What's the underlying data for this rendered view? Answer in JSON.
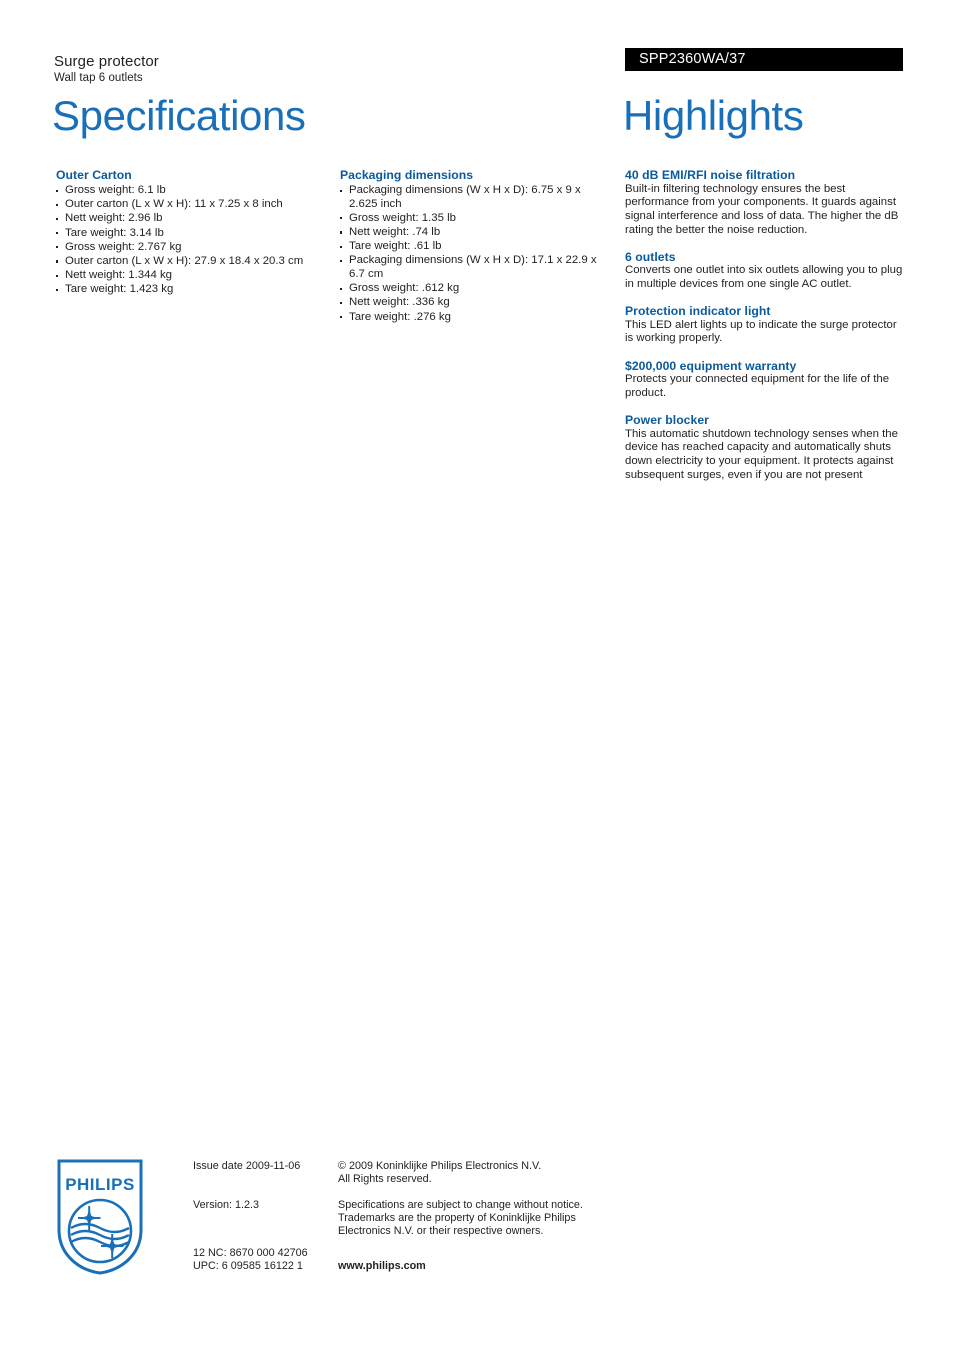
{
  "header": {
    "product_category": "Surge protector",
    "product_subtitle": "Wall tap 6 outlets",
    "product_code": "SPP2360WA/37",
    "title_left": "Specifications",
    "title_right": "Highlights"
  },
  "specifications": [
    {
      "heading": "Outer Carton",
      "items": [
        "Gross weight: 6.1 lb",
        "Outer carton (L x W x H): 11 x 7.25 x 8 inch",
        "Nett weight: 2.96 lb",
        "Tare weight: 3.14 lb",
        "Gross weight: 2.767 kg",
        "Outer carton (L x W x H): 27.9 x 18.4 x 20.3 cm",
        "Nett weight: 1.344 kg",
        "Tare weight: 1.423 kg"
      ]
    },
    {
      "heading": "Packaging dimensions",
      "items": [
        "Packaging dimensions (W x H x D): 6.75 x 9 x 2.625 inch",
        "Gross weight: 1.35 lb",
        "Nett weight: .74 lb",
        "Tare weight: .61 lb",
        "Packaging dimensions (W x H x D): 17.1 x 22.9 x 6.7 cm",
        "Gross weight: .612 kg",
        "Nett weight: .336 kg",
        "Tare weight: .276 kg"
      ]
    }
  ],
  "highlights": [
    {
      "title": "40 dB EMI/RFI noise filtration",
      "body": "Built-in filtering technology ensures the best performance from your components. It guards against signal interference and loss of data. The higher the dB rating the better the noise reduction."
    },
    {
      "title": "6 outlets",
      "body": "Converts one outlet into six outlets allowing you to plug in multiple devices from one single AC outlet."
    },
    {
      "title": "Protection indicator light",
      "body": "This LED alert lights up to indicate the surge protector is working properly."
    },
    {
      "title": "$200,000 equipment warranty",
      "body": "Protects your connected equipment for the life of the product."
    },
    {
      "title": "Power blocker",
      "body": "This automatic shutdown technology senses when the device has reached capacity and automatically shuts down electricity to your equipment. It protects against subsequent surges, even if you are not present"
    }
  ],
  "footer": {
    "logo_wordmark": "PHILIPS",
    "issue_date": "Issue date 2009-11-06",
    "version": "Version: 1.2.3",
    "twelve_nc": "12 NC: 8670 000 42706",
    "upc": "UPC: 6 09585 16122 1",
    "copyright_line1": "© 2009 Koninklijke Philips Electronics N.V.",
    "copyright_line2": "All Rights reserved.",
    "disclaimer": "Specifications are subject to change without notice. Trademarks are the property of Koninklijke Philips Electronics N.V. or their respective owners.",
    "website": "www.philips.com"
  },
  "colors": {
    "title_blue": "#1a70b8",
    "heading_blue": "#0a5a9c",
    "body_text": "#231f20",
    "code_bar_bg": "#000000",
    "logo_blue": "#1a70b8"
  }
}
